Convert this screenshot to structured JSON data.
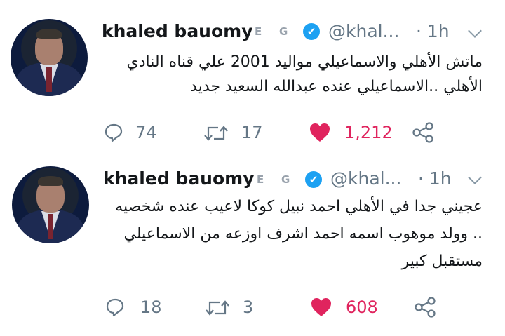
{
  "tweets": [
    {
      "author_name": "khaled bauomy",
      "badge_e": "E",
      "badge_g": "G",
      "verified_glyph": "✔",
      "handle": "@khal...",
      "time": "· 1h",
      "text_lines": [
        "ماتش الأهلي والاسماعيلي مواليد 2001  علي قناه النادي",
        "الأهلي ..الاسماعيلي عنده عبدالله السعيد جديد"
      ],
      "reply_count": "74",
      "retweet_count": "17",
      "like_count": "1,212"
    },
    {
      "author_name": "khaled bauomy",
      "badge_e": "E",
      "badge_g": "G",
      "verified_glyph": "✔",
      "handle": "@khal...",
      "time": "· 1h",
      "text_lines": [
        "عجيني جدا في الأهلي احمد نبيل كوكا لاعيب عنده شخصيه",
        ".. وولد موهوب اسمه احمد اشرف اوزعه من الاسماعيلي",
        "مستقبل كبير"
      ],
      "reply_count": "18",
      "retweet_count": "3",
      "like_count": "608"
    }
  ],
  "icons": {
    "reply": "reply-icon",
    "retweet": "retweet-icon",
    "like": "heart-icon",
    "share": "share-icon",
    "menu": "chevron-down-icon",
    "verified": "verified-icon"
  },
  "colors": {
    "accent": "#1da1f2",
    "like": "#e0245e",
    "muted": "#657786"
  }
}
